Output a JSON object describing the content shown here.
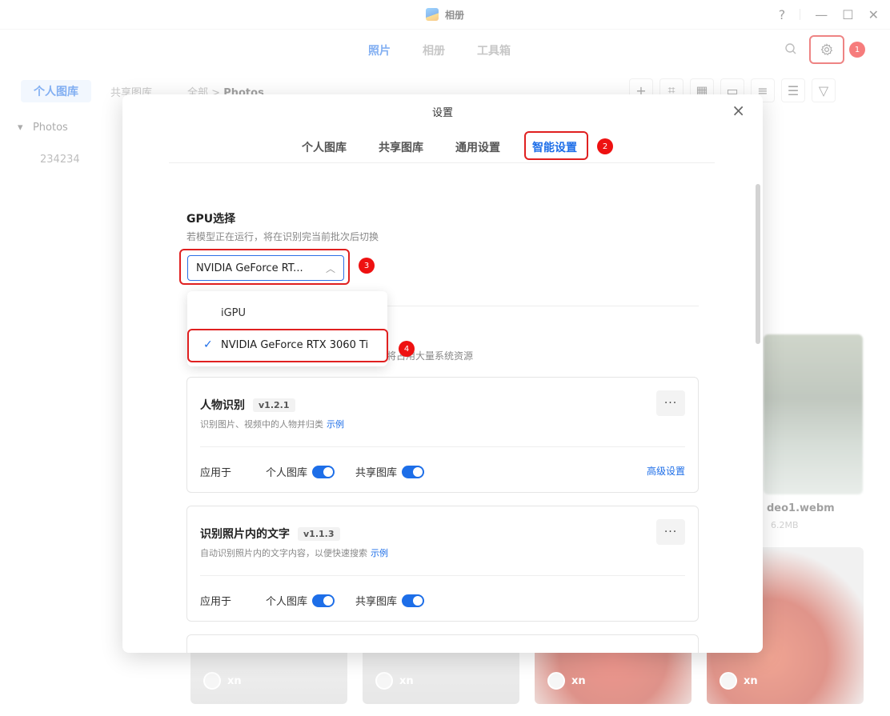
{
  "window": {
    "title": "相册",
    "help": "?",
    "minimize": "—",
    "maximize": "☐",
    "close": "✕"
  },
  "nav": {
    "tabs": [
      "照片",
      "相册",
      "工具箱"
    ],
    "active_tab": "照片"
  },
  "background": {
    "library_pill": "个人图库",
    "shared_pill": "共享图库",
    "breadcrumb_root": "全部",
    "breadcrumb_sep": ">",
    "breadcrumb_current": "Photos",
    "tree_root": "Photos",
    "tree_child": "234234",
    "file_name": "deo1.webm",
    "file_size": "6.2MB",
    "thumb_user": "xn"
  },
  "annotations": [
    "1",
    "2",
    "3",
    "4"
  ],
  "dialog": {
    "title": "设置",
    "close": "×",
    "tabs": [
      "个人图库",
      "共享图库",
      "通用设置",
      "智能设置"
    ],
    "active_tab": "智能设置",
    "gpu": {
      "title": "GPU选择",
      "description": "若模型正在运行，将在识别完当前批次后切换",
      "selected_display": "NVIDIA GeForce RT...",
      "options": [
        "iGPU",
        "NVIDIA GeForce RTX 3060 Ti"
      ],
      "selected_option": "NVIDIA GeForce RTX 3060 Ti",
      "warning_partial": "将占用大量系统资源"
    },
    "models": [
      {
        "name": "人物识别",
        "version": "v1.2.1",
        "description": "识别图片、视频中的人物并归类",
        "example": "示例",
        "apply_label": "应用于",
        "personal_label": "个人图库",
        "shared_label": "共享图库",
        "personal_on": true,
        "shared_on": true,
        "advanced": "高级设置"
      },
      {
        "name": "识别照片内的文字",
        "version": "v1.1.3",
        "description": "自动识别照片内的文字内容，以便快速搜索",
        "example": "示例",
        "apply_label": "应用于",
        "personal_label": "个人图库",
        "shared_label": "共享图库",
        "personal_on": true,
        "shared_on": true
      }
    ],
    "more": "···"
  },
  "colors": {
    "accent": "#1d6ee8",
    "highlight": "#e02020"
  }
}
